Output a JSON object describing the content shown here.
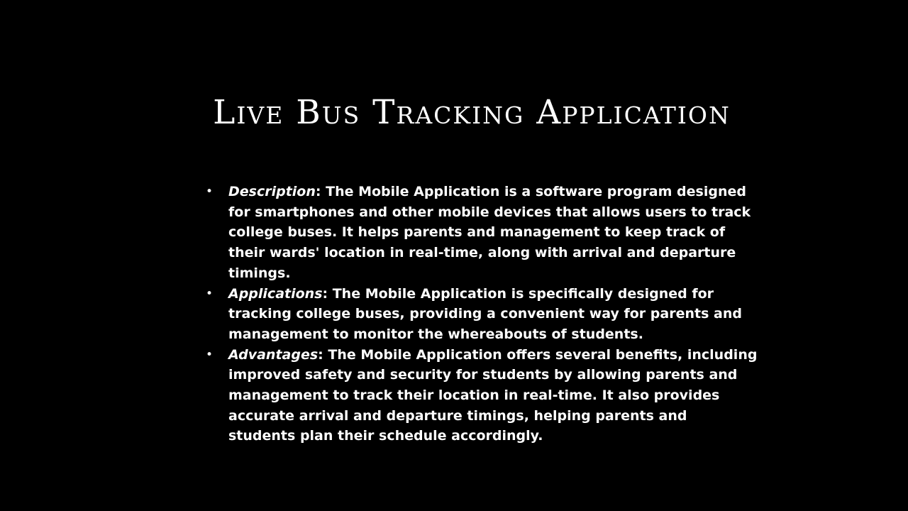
{
  "slide": {
    "title": "Live Bus Tracking Application",
    "background_color": "#000000",
    "text_color": "#ffffff",
    "bullet_glyph": "•",
    "bullets": [
      {
        "term": "Description",
        "text": ": The Mobile Application is a software program designed for smartphones and other mobile devices that allows users to track college buses. It helps parents and management to keep track of  their wards' location in real-time, along with arrival and departure timings."
      },
      {
        "term": "Applications",
        "text": ": The Mobile Application is specifically designed for tracking college buses, providing a convenient way for parents and management to monitor the whereabouts of students."
      },
      {
        "term": "Advantages",
        "text": ": The Mobile Application offers several benefits, including improved safety and security for students by allowing parents and management to track their location in real-time. It also provides accurate arrival and departure timings, helping parents and students plan their schedule accordingly."
      }
    ]
  }
}
